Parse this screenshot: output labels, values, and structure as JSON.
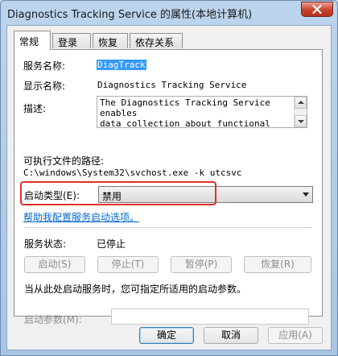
{
  "window": {
    "title": "Diagnostics Tracking Service 的属性(本地计算机)"
  },
  "tabs": [
    {
      "label": "常规",
      "active": true
    },
    {
      "label": "登录",
      "active": false
    },
    {
      "label": "恢复",
      "active": false
    },
    {
      "label": "依存关系",
      "active": false
    }
  ],
  "general": {
    "service_name_label": "服务名称:",
    "service_name_value": "DiagTrack",
    "display_name_label": "显示名称:",
    "display_name_value": "Diagnostics Tracking Service",
    "description_label": "描述:",
    "description_lines": [
      "The Diagnostics Tracking Service enables",
      "data collection about functional issues"
    ],
    "path_label": "可执行文件的路径:",
    "path_value": "C:\\windows\\System32\\svchost.exe -k utcsvc",
    "startup_type_label": "启动类型(E):",
    "startup_type_value": "禁用",
    "help_link": "帮助我配置服务启动选项。",
    "status_label": "服务状态:",
    "status_value": "已停止",
    "buttons": {
      "start": "启动(S)",
      "stop": "停止(T)",
      "pause": "暂停(P)",
      "resume": "恢复(R)"
    },
    "start_params_hint": "当从此处启动服务时，您可指定所适用的启动参数。",
    "start_params_label": "启动参数(M):",
    "start_params_value": ""
  },
  "footer": {
    "ok": "确定",
    "cancel": "取消",
    "apply": "应用(A)"
  },
  "colors": {
    "highlight_box": "#e0302a",
    "link": "#0066cc",
    "selection": "#3399ff"
  }
}
